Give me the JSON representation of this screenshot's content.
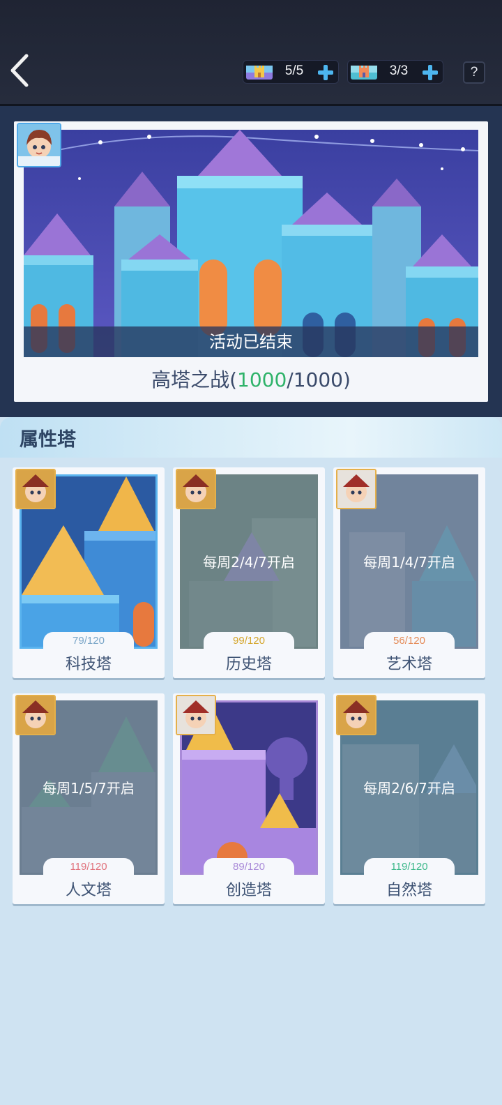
{
  "header": {
    "currencies": [
      {
        "count": "5/5"
      },
      {
        "count": "3/3"
      }
    ],
    "help_label": "?"
  },
  "hero": {
    "banner_text": "活动已结束",
    "title_name": "高塔之战(",
    "title_current": "1000",
    "title_rest": "/1000)"
  },
  "section": {
    "title": "属性塔"
  },
  "towers": [
    {
      "name": "科技塔",
      "progress": "79/120",
      "progress_color": "#7aa6c8",
      "schedule": "",
      "locked": false,
      "theme": "tech"
    },
    {
      "name": "历史塔",
      "progress": "99/120",
      "progress_color": "#d4a52a",
      "schedule": "每周2/4/7开启",
      "locked": true,
      "theme": "history"
    },
    {
      "name": "艺术塔",
      "progress": "56/120",
      "progress_color": "#e48a56",
      "schedule": "每周1/4/7开启",
      "locked": true,
      "theme": "art"
    },
    {
      "name": "人文塔",
      "progress": "119/120",
      "progress_color": "#e0707a",
      "schedule": "每周1/5/7开启",
      "locked": true,
      "theme": "humanity"
    },
    {
      "name": "创造塔",
      "progress": "89/120",
      "progress_color": "#a98ad8",
      "schedule": "",
      "locked": false,
      "theme": "create"
    },
    {
      "name": "自然塔",
      "progress": "119/120",
      "progress_color": "#3cb88a",
      "schedule": "每周2/6/7开启",
      "locked": true,
      "theme": "nature"
    }
  ]
}
